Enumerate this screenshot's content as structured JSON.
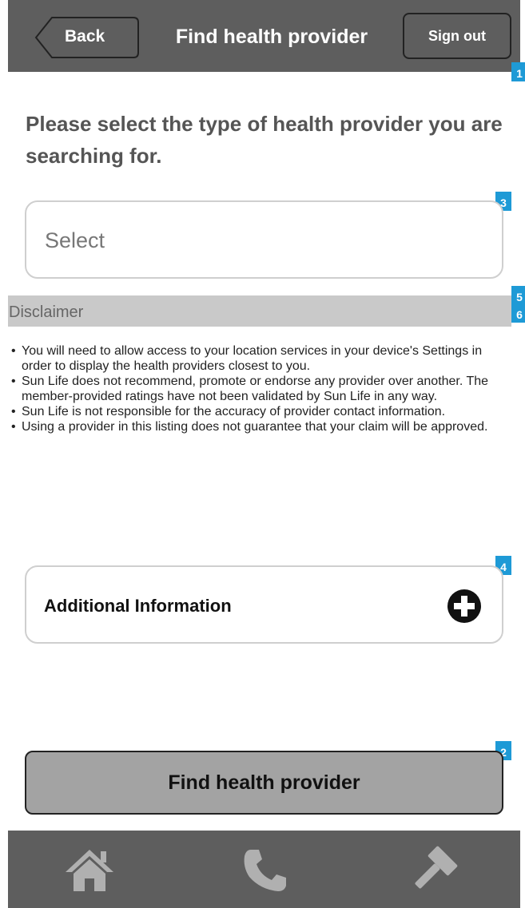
{
  "header": {
    "back_label": "Back",
    "title": "Find health provider",
    "signout_label": "Sign out"
  },
  "main": {
    "prompt": "Please select the type of health provider you are searching for.",
    "select": {
      "value": "Select"
    },
    "disclaimer": {
      "label": "Disclaimer",
      "items": [
        "You will need to allow access to your location services in your device's Settings in order to display the health providers closest to you.",
        "Sun Life does not recommend, promote or endorse any provider over another.  The member-provided ratings have not been validated by Sun Life in any way.",
        "Sun Life is not responsible for the accuracy of provider contact information.",
        "Using a provider in this listing does not guarantee that your claim will be approved."
      ]
    },
    "additional_info": {
      "label": "Additional Information",
      "icon": "plus-circle-icon"
    },
    "find_button_label": "Find health provider"
  },
  "annotation_markers": [
    "1",
    "2",
    "3",
    "4",
    "5",
    "6"
  ],
  "tabbar": {
    "icons": [
      "home-icon",
      "phone-icon",
      "gavel-icon"
    ]
  },
  "colors": {
    "header_bg": "#5e5e5e",
    "marker_blue": "#1e9ad6",
    "disclaimer_bar": "#c9c9c9",
    "find_button_bg": "#a3a3a3"
  }
}
